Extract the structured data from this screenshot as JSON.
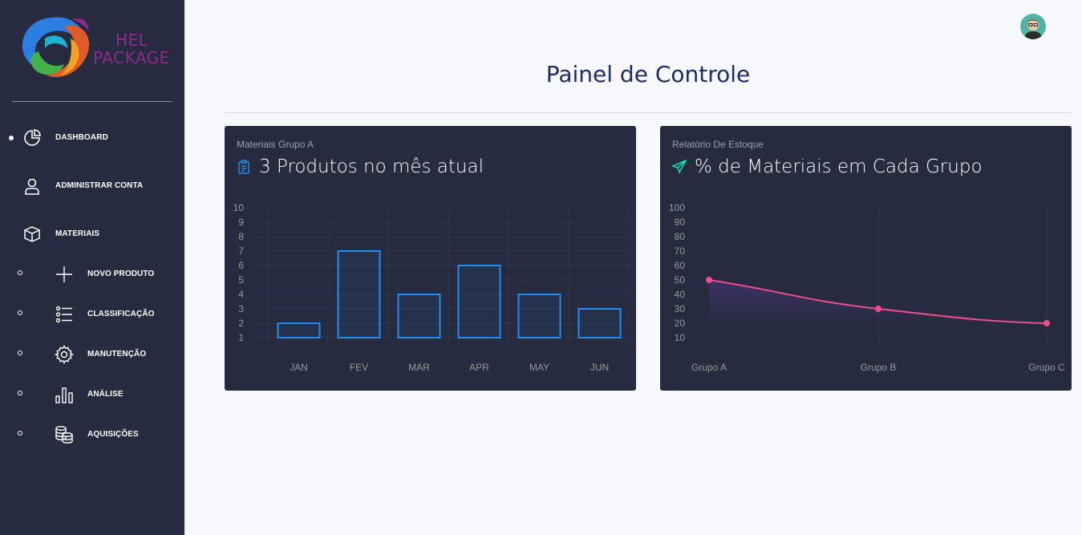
{
  "brand": {
    "line1": "HEL",
    "line2": "PACKAGE"
  },
  "sidebar": {
    "items": [
      {
        "label": "DASHBOARD",
        "icon": "pie-chart-icon"
      },
      {
        "label": "ADMINISTRAR CONTA",
        "icon": "user-icon"
      },
      {
        "label": "MATERIAIS",
        "icon": "box-icon"
      },
      {
        "label": "NOVO PRODUTO",
        "icon": "plus-icon"
      },
      {
        "label": "CLASSIFICAÇÃO",
        "icon": "list-icon"
      },
      {
        "label": "MANUTENÇÃO",
        "icon": "gear-icon"
      },
      {
        "label": "ANÁLISE",
        "icon": "bar-chart-icon"
      },
      {
        "label": "AQUISIÇÕES",
        "icon": "coins-icon"
      }
    ]
  },
  "header": {
    "title": "Painel de Controle"
  },
  "colors": {
    "sidebar": "#272b3f",
    "card": "#272b3f",
    "bar": "#1f8ef1",
    "line": "#ec4e8d",
    "accent_teal": "#00f2c3"
  },
  "cards": [
    {
      "subtitle": "Materiais Grupo A",
      "title": "3 Produtos no mês atual",
      "icon": "clipboard-icon"
    },
    {
      "subtitle": "Relatório De Estoque",
      "title": "% de Materiais em Cada Grupo",
      "icon": "send-icon"
    }
  ],
  "chart_data": [
    {
      "type": "bar",
      "categories": [
        "JAN",
        "FEV",
        "MAR",
        "APR",
        "MAY",
        "JUN"
      ],
      "values": [
        2,
        7,
        4,
        6,
        4,
        3
      ],
      "yticks": [
        1,
        2,
        3,
        4,
        5,
        6,
        7,
        8,
        9,
        10
      ],
      "ylim": [
        1,
        10
      ],
      "grid": true
    },
    {
      "type": "line",
      "categories": [
        "Grupo A",
        "Grupo B",
        "Grupo C"
      ],
      "values": [
        50,
        30,
        20
      ],
      "yticks": [
        10,
        20,
        30,
        40,
        50,
        60,
        70,
        80,
        90,
        100
      ],
      "ylim": [
        10,
        100
      ],
      "grid": true
    }
  ]
}
